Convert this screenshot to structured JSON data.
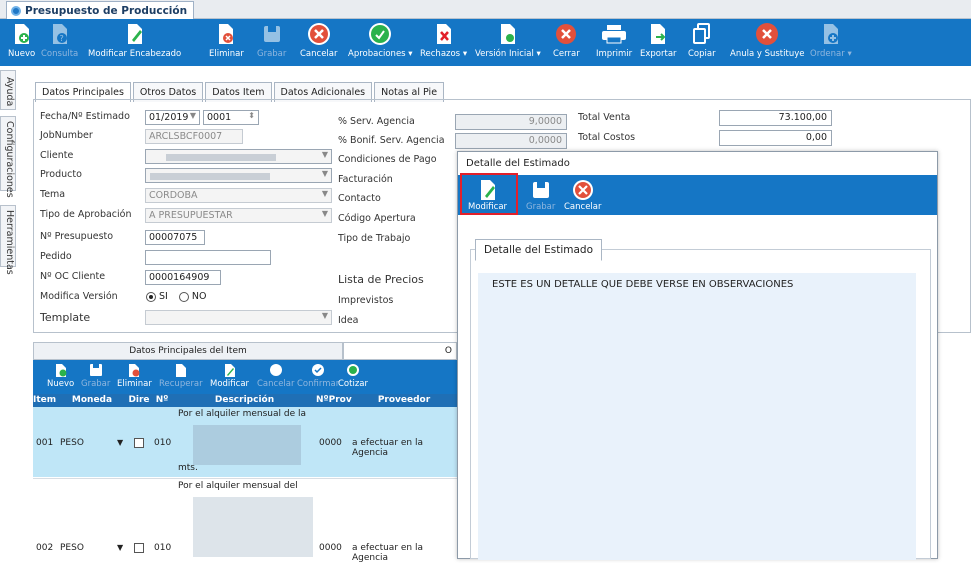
{
  "window": {
    "title": "Presupuesto de Producción"
  },
  "ribbon": [
    {
      "label": "Nuevo",
      "icon": "new-doc-icon",
      "enabled": true
    },
    {
      "label": "Consulta",
      "icon": "query-doc-icon",
      "enabled": false
    },
    {
      "label": "Modificar Encabezado",
      "icon": "edit-doc-icon",
      "enabled": true
    },
    {
      "label": "Eliminar",
      "icon": "delete-doc-icon",
      "enabled": true
    },
    {
      "label": "Grabar",
      "icon": "save-icon",
      "enabled": false
    },
    {
      "label": "Cancelar",
      "icon": "cancel-icon",
      "enabled": true
    },
    {
      "label": "Aprobaciones ▾",
      "icon": "approve-icon",
      "enabled": true
    },
    {
      "label": "Rechazos ▾",
      "icon": "reject-icon",
      "enabled": true
    },
    {
      "label": "Versión Inicial ▾",
      "icon": "version-icon",
      "enabled": true
    },
    {
      "label": "Cerrar",
      "icon": "close-x-icon",
      "enabled": true
    },
    {
      "label": "Imprimir",
      "icon": "printer-icon",
      "enabled": true
    },
    {
      "label": "Exportar",
      "icon": "export-icon",
      "enabled": true
    },
    {
      "label": "Copiar",
      "icon": "copy-icon",
      "enabled": true
    },
    {
      "label": "Anula y Sustituye",
      "icon": "void-replace-icon",
      "enabled": true
    },
    {
      "label": "Ordenar ▾",
      "icon": "sort-icon",
      "enabled": false
    }
  ],
  "sidetabs": [
    "Ayuda",
    "Configuraciones",
    "Herramientas"
  ],
  "tabs": [
    {
      "label": "Datos Principales",
      "active": true
    },
    {
      "label": "Otros Datos",
      "active": false
    },
    {
      "label": "Datos Item",
      "active": false
    },
    {
      "label": "Datos Adicionales",
      "active": false
    },
    {
      "label": "Notas al Pie",
      "active": false
    }
  ],
  "form": {
    "fecha_label": "Fecha/Nº Estimado",
    "fecha_value": "01/2019",
    "estimado_value": "0001",
    "jobnumber_label": "JobNumber",
    "jobnumber_value": "ARCLSBCF0007",
    "cliente_label": "Cliente",
    "producto_label": "Producto",
    "tema_label": "Tema",
    "tema_value": "CORDOBA",
    "tipoaprob_label": "Tipo de Aprobación",
    "tipoaprob_value": "A PRESUPUESTAR",
    "presupuesto_label": "Nº Presupuesto",
    "presupuesto_value": "00007075",
    "pedido_label": "Pedido",
    "pedido_value": "",
    "oc_label": "Nº OC Cliente",
    "oc_value": "0000164909",
    "modversion_label": "Modifica Versión",
    "radio_si": "SI",
    "radio_no": "NO",
    "template_label": "Template"
  },
  "mid": {
    "serv_agencia_label": "% Serv. Agencia",
    "serv_agencia_value": "9,0000",
    "bonif_label": "% Bonif. Serv. Agencia",
    "bonif_value": "0,0000",
    "condiciones_label": "Condiciones de Pago",
    "facturacion_label": "Facturación",
    "contacto_label": "Contacto",
    "codigo_label": "Código Apertura",
    "tipotrabajo_label": "Tipo de Trabajo",
    "lista_label": "Lista de Precios",
    "imprevistos_label": "Imprevistos",
    "idea_label": "Idea"
  },
  "totals": {
    "venta_label": "Total Venta",
    "venta_value": "73.100,00",
    "costos_label": "Total Costos",
    "costos_value": "0,00"
  },
  "items": {
    "tab1": "Datos Principales del Item",
    "tab2_partial": "O",
    "toolbar": [
      {
        "label": "Nuevo",
        "icon": "new-doc-icon",
        "enabled": true
      },
      {
        "label": "Grabar",
        "icon": "save-icon",
        "enabled": false
      },
      {
        "label": "Eliminar",
        "icon": "delete-doc-icon",
        "enabled": true
      },
      {
        "label": "Recuperar",
        "icon": "recover-icon",
        "enabled": false
      },
      {
        "label": "Modificar",
        "icon": "edit-doc-icon",
        "enabled": true
      },
      {
        "label": "Cancelar",
        "icon": "cancel-icon",
        "enabled": false
      },
      {
        "label": "Confirmar",
        "icon": "check-icon",
        "enabled": false
      },
      {
        "label": "Cotizar",
        "icon": "quote-icon",
        "enabled": true
      }
    ],
    "columns": [
      "Item",
      "Moneda",
      "Dire",
      "Nº",
      "Descripción",
      "NºProv",
      "Proveedor"
    ],
    "rows": [
      {
        "item": "001",
        "moneda": "PESO",
        "n": "010",
        "desc1": "Por el alquiler mensual de la",
        "desc_last": "mts.",
        "nprov": "0000",
        "proveedor": "a efectuar en la Agencia"
      },
      {
        "item": "002",
        "moneda": "PESO",
        "n": "010",
        "desc1": "Por el alquiler mensual del",
        "desc_last": "",
        "nprov": "0000",
        "proveedor": "a efectuar en la Agencia"
      }
    ]
  },
  "modal": {
    "title": "Detalle del Estimado",
    "toolbar": [
      {
        "label": "Modificar",
        "icon": "edit-doc-icon",
        "enabled": true
      },
      {
        "label": "Grabar",
        "icon": "save-icon",
        "enabled": false
      },
      {
        "label": "Cancelar",
        "icon": "cancel-icon",
        "enabled": true
      }
    ],
    "tab": "Detalle del Estimado",
    "text": "ESTE ES UN DETALLE QUE DEBE VERSE EN OBSERVACIONES"
  },
  "colors": {
    "ribbon": "#1576c5",
    "highlight": "#e2202a",
    "row_selected": "#bfe6f7"
  }
}
